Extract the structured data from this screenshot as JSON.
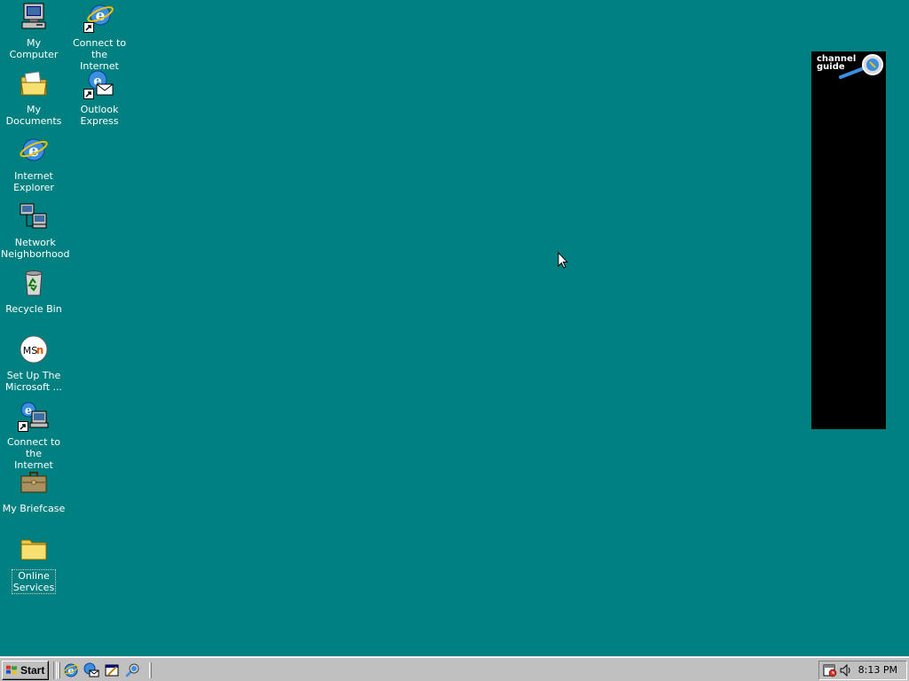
{
  "desktop": {
    "background_color": "#008080",
    "icons": [
      {
        "label": "My Computer",
        "icon": "my-computer-icon"
      },
      {
        "label": "Connect to the\nInternet",
        "icon": "connect-internet-icon",
        "shortcut": true
      },
      {
        "label": "My Documents",
        "icon": "my-documents-icon"
      },
      {
        "label": "Outlook\nExpress",
        "icon": "outlook-express-icon",
        "shortcut": true
      },
      {
        "label": "Internet\nExplorer",
        "icon": "internet-explorer-icon"
      },
      {
        "label": "Network\nNeighborhood",
        "icon": "network-neighborhood-icon"
      },
      {
        "label": "Recycle Bin",
        "icon": "recycle-bin-icon"
      },
      {
        "label": "Set Up The\nMicrosoft ...",
        "icon": "msn-icon"
      },
      {
        "label": "Connect to the\nInternet",
        "icon": "connect-internet-icon",
        "shortcut": true
      },
      {
        "label": "My Briefcase",
        "icon": "briefcase-icon"
      },
      {
        "label": "Online\nServices",
        "icon": "folder-icon",
        "selected": true
      }
    ]
  },
  "channel_bar": {
    "guide_text": "channel\nguide",
    "background_color": "#000000"
  },
  "taskbar": {
    "start_label": "Start",
    "quick_launch": [
      {
        "name": "internet-explorer-icon"
      },
      {
        "name": "outlook-express-icon"
      },
      {
        "name": "show-desktop-icon"
      },
      {
        "name": "view-channels-icon"
      }
    ],
    "tray": {
      "icons": [
        "task-scheduler-icon",
        "volume-icon"
      ],
      "clock": "8:13 PM"
    }
  }
}
